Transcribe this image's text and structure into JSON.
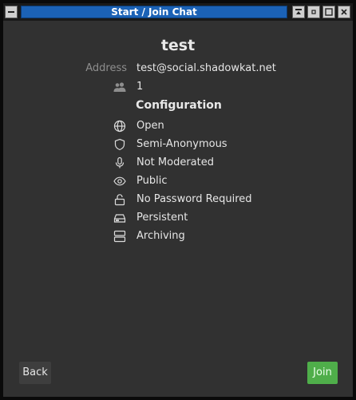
{
  "window": {
    "title": "Start / Join Chat"
  },
  "room": {
    "name": "test",
    "address_label": "Address",
    "address": "test@social.shadowkat.net",
    "occupants": "1"
  },
  "configuration": {
    "title": "Configuration",
    "items": [
      {
        "icon": "globe-icon",
        "label": "Open"
      },
      {
        "icon": "shield-icon",
        "label": "Semi-Anonymous"
      },
      {
        "icon": "microphone-icon",
        "label": "Not Moderated"
      },
      {
        "icon": "eye-icon",
        "label": "Public"
      },
      {
        "icon": "unlock-icon",
        "label": "No Password Required"
      },
      {
        "icon": "hard-drive-icon",
        "label": "Persistent"
      },
      {
        "icon": "server-icon",
        "label": "Archiving"
      }
    ]
  },
  "actions": {
    "back_label": "Back",
    "join_label": "Join"
  },
  "colors": {
    "title_bar": "#1b62b6",
    "background": "#313131",
    "join_button": "#4fae4a"
  }
}
